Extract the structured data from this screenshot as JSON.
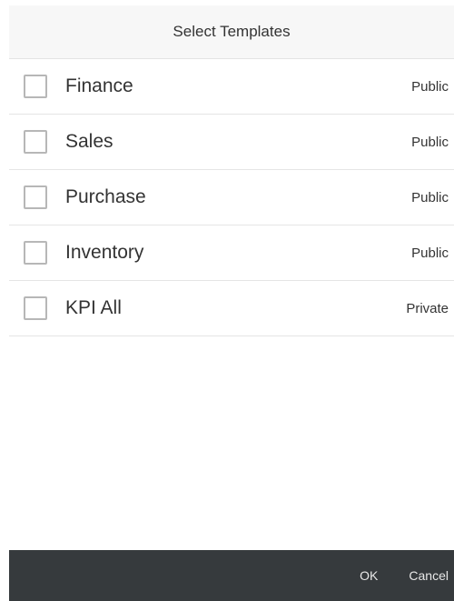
{
  "dialog": {
    "title": "Select Templates",
    "templates": [
      {
        "label": "Finance",
        "visibility": "Public",
        "checked": false
      },
      {
        "label": "Sales",
        "visibility": "Public",
        "checked": false
      },
      {
        "label": "Purchase",
        "visibility": "Public",
        "checked": false
      },
      {
        "label": "Inventory",
        "visibility": "Public",
        "checked": false
      },
      {
        "label": "KPI All",
        "visibility": "Private",
        "checked": false
      }
    ],
    "footer": {
      "ok_label": "OK",
      "cancel_label": "Cancel"
    }
  },
  "colors": {
    "header_bg": "#f7f7f7",
    "footer_bg": "#363a3d",
    "checkbox_border": "#b7b7b7",
    "divider": "#e5e5e5",
    "text": "#333333"
  }
}
